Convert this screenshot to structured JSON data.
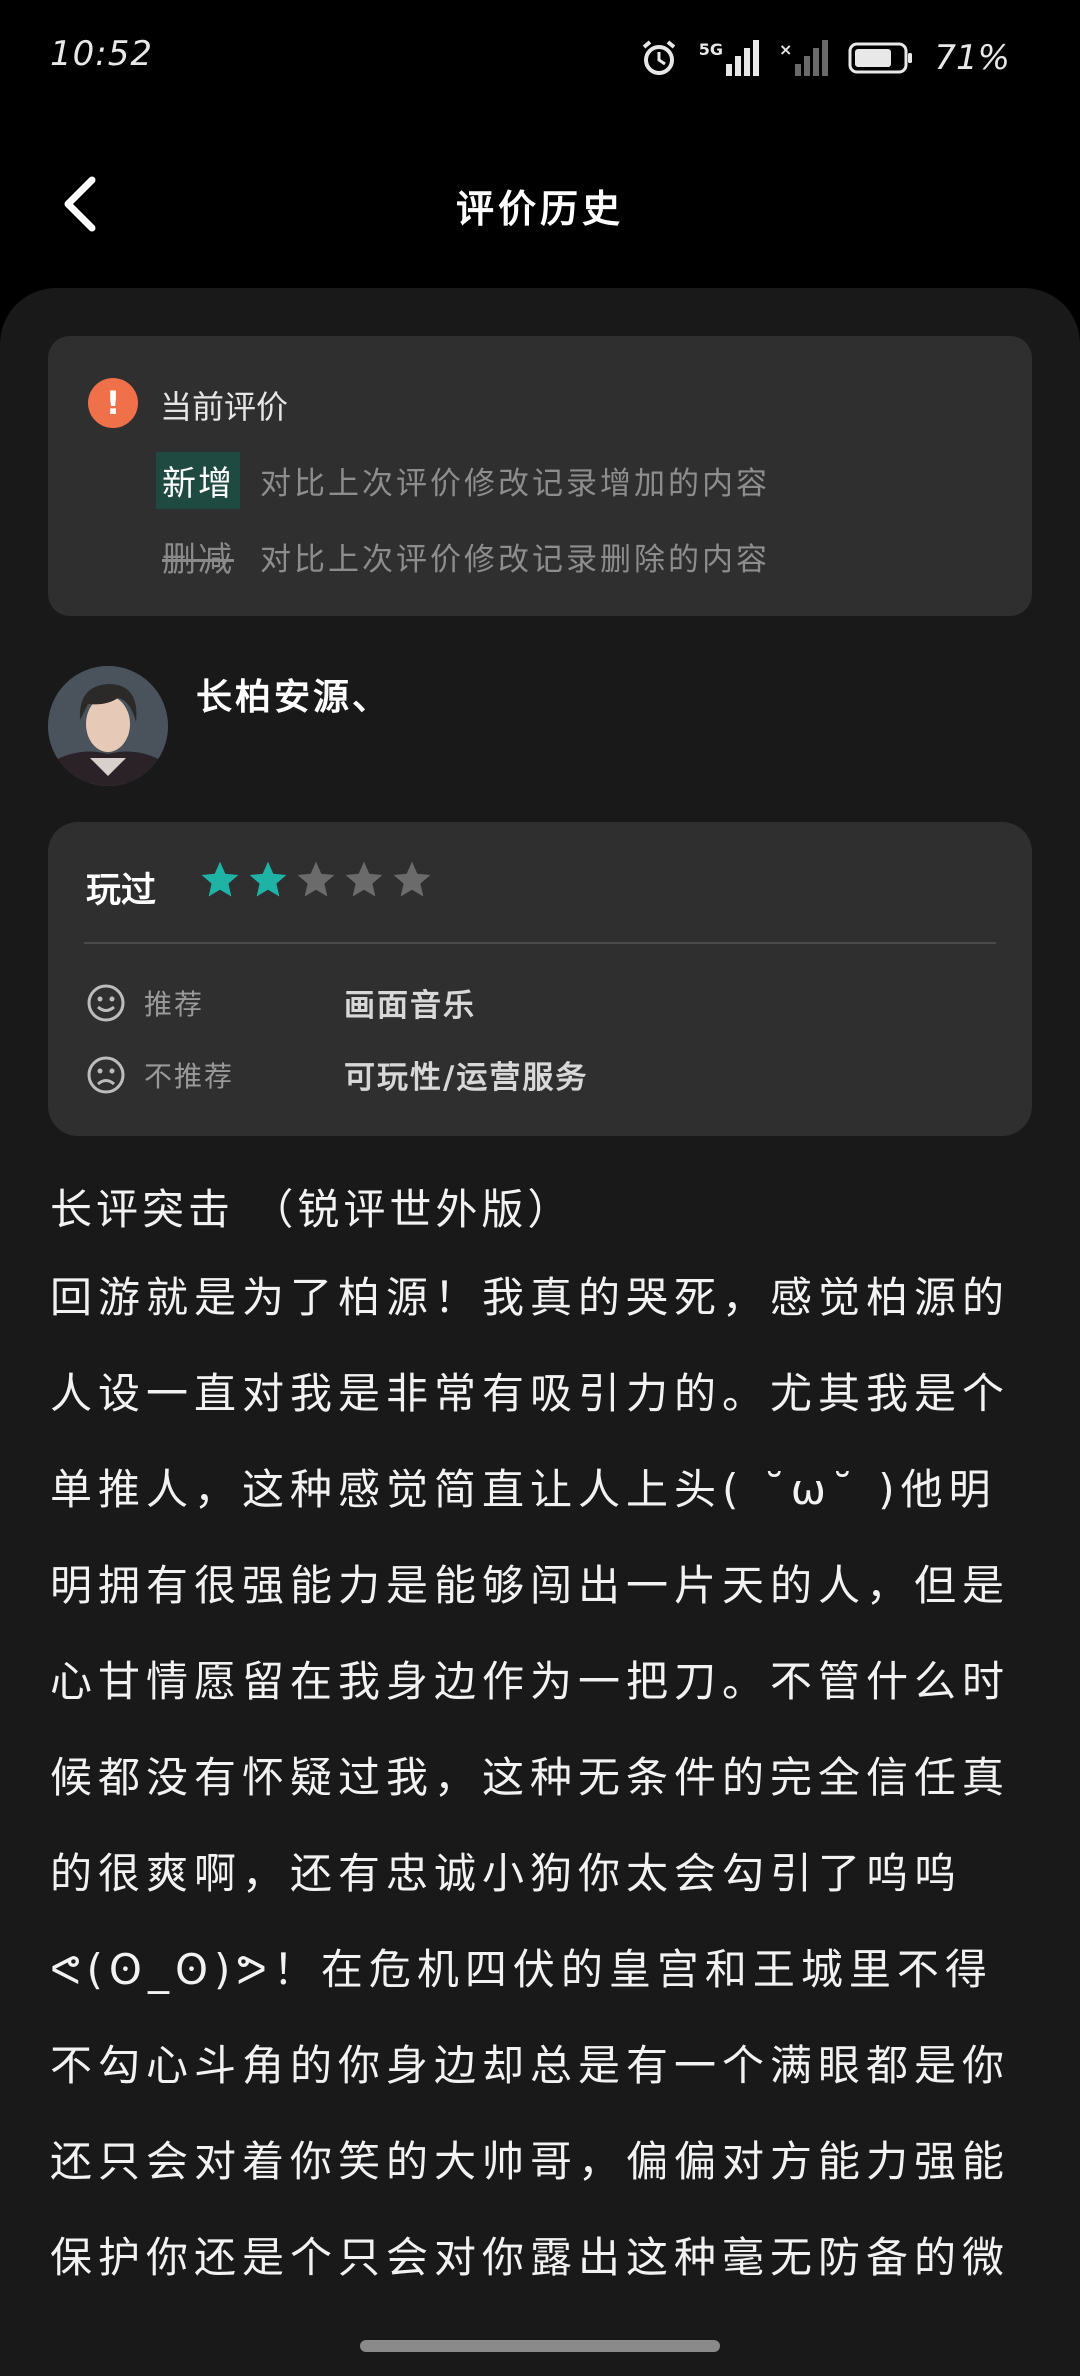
{
  "status_bar": {
    "time": "10:52",
    "network": "5G",
    "battery": "71%"
  },
  "header": {
    "title": "评价历史"
  },
  "legend": {
    "title": "当前评价",
    "added_tag": "新增",
    "added_desc": "对比上次评价修改记录增加的内容",
    "deleted_tag": "删减",
    "deleted_desc": "对比上次评价修改记录删除的内容"
  },
  "user": {
    "name": "长柏安源、"
  },
  "rating": {
    "label": "玩过",
    "stars": 2,
    "max_stars": 5,
    "recommend_label": "推荐",
    "recommend_value": "画面音乐",
    "not_recommend_label": "不推荐",
    "not_recommend_value": "可玩性/运营服务"
  },
  "review": {
    "title": "长评突击 （锐评世外版）",
    "body": "回游就是为了柏源！我真的哭死，感觉柏源的人设一直对我是非常有吸引力的。尤其我是个单推人，这种感觉简直让人上头( ˘ω˘ )他明明拥有很强能力是能够闯出一片天的人，但是心甘情愿留在我身边作为一把刀。不管什么时候都没有怀疑过我，这种无条件的完全信任真的很爽啊，还有忠诚小狗你太会勾引了呜呜ᕙ(ʘ_ʘ)ᕗ！在危机四伏的皇宫和王城里不得不勾心斗角的你身边却总是有一个满眼都是你还只会对着你笑的大帅哥，偏偏对方能力强能保护你还是个只会对你露出这种毫无防备的微"
  },
  "colors": {
    "star_filled": "#1fb3a5",
    "star_empty": "#6b6b6b",
    "alert": "#f0704a",
    "added_bg": "#1e4a42"
  }
}
